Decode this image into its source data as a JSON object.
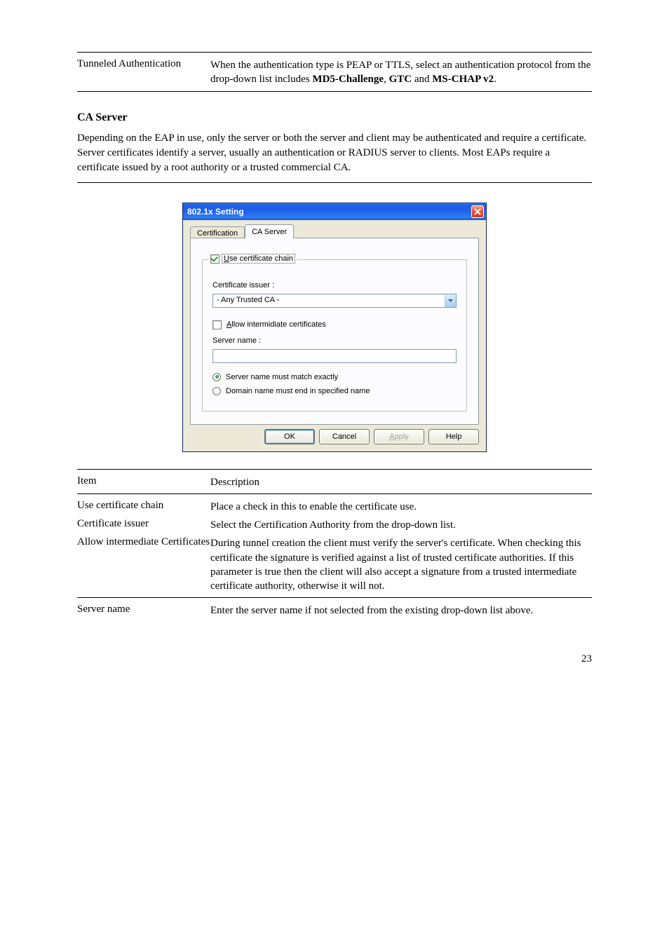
{
  "doc": {
    "row1_label": "Tunneled Authentication",
    "row1_desc": "When the authentication type is PEAP or TTLS, select an authentication protocol from the drop-down list includes MD5-Challenge ,GTC and MS-CHAP v2 .",
    "ca_server_title": "CA Server",
    "ca_intro": "Depending on the EAP in use, only the server or both the server and client may be authenticated and require a certificate. Server certificates identify a server, usually an authentication or RADIUS server to clients.   Most EAPs require a certificate issued by a root authority or a trusted commercial CA.",
    "row2_label": "Item",
    "row2_desc": "Description",
    "row3_label": "Use certificate chain",
    "row3_desc": "Place a check in this to enable the certificate use.",
    "row4_label": "Certificate issuer",
    "row4_desc": "Select the Certification Authority from the drop-down list.",
    "row5_label": "Allow intermediate Certificates",
    "row5_desc": "During tunnel creation the client must verify the server's certificate. When checking this certificate the signature is verified against a list of trusted certificate authorities. If this parameter is true then the client will also accept a signature from a trusted intermediate certificate authority, otherwise it will not.",
    "row6_label": "Server name",
    "row6_desc": "Enter the server name if not selected from the existing drop-down list above.",
    "page_num": "23"
  },
  "dialog": {
    "title": "802.1x Setting",
    "tabs": {
      "certification": "Certification",
      "ca_server": "CA Server"
    },
    "group_legend": "Use certificate chain",
    "cert_issuer_label": "Certificate issuer :",
    "dropdown_value": "- Any Trusted CA -",
    "allow_intermediate": "Allow intermidiate certificates",
    "server_name_label": "Server name :",
    "server_name_value": "",
    "radio_exact": "Server name must match exactly",
    "radio_domain": "Domain name must end in specified name",
    "buttons": {
      "ok": "OK",
      "cancel": "Cancel",
      "apply": "Apply",
      "help": "Help"
    }
  }
}
